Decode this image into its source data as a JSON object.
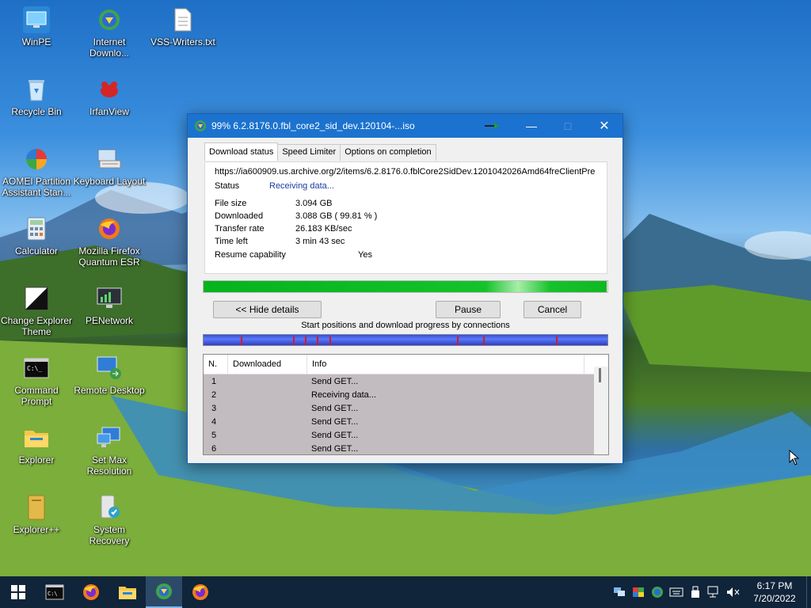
{
  "desktop": {
    "icons": [
      {
        "label": "WinPE"
      },
      {
        "label": "Internet Downlo..."
      },
      {
        "label": "VSS-Writers.txt"
      },
      {
        "label": "Recycle Bin"
      },
      {
        "label": "IrfanView"
      },
      {
        "label": "AOMEI Partition Assistant Stan..."
      },
      {
        "label": "Keyboard Layout"
      },
      {
        "label": "Calculator"
      },
      {
        "label": "Mozilla Firefox Quantum ESR"
      },
      {
        "label": "Change Explorer Theme"
      },
      {
        "label": "PENetwork"
      },
      {
        "label": "Command Prompt"
      },
      {
        "label": "Remote Desktop"
      },
      {
        "label": "Explorer"
      },
      {
        "label": "Set Max Resolution"
      },
      {
        "label": "Explorer++"
      },
      {
        "label": "System Recovery"
      }
    ]
  },
  "window": {
    "title": "99% 6.2.8176.0.fbl_core2_sid_dev.120104-...iso",
    "tabs": [
      "Download status",
      "Speed Limiter",
      "Options on completion"
    ],
    "url": "https://ia600909.us.archive.org/2/items/6.2.8176.0.fblCore2SidDev.1201042026Amd64freClientPre",
    "status_label": "Status",
    "status_value": "Receiving data...",
    "file_size_label": "File size",
    "file_size_value": "3.094  GB",
    "downloaded_label": "Downloaded",
    "downloaded_value": "3.088  GB  ( 99.81 % )",
    "transfer_rate_label": "Transfer rate",
    "transfer_rate_value": "26.183  KB/sec",
    "time_left_label": "Time left",
    "time_left_value": "3 min 43 sec",
    "resume_label": "Resume capability",
    "resume_value": "Yes",
    "progress_fraction": 0.9981,
    "hide_details_label": "<< Hide details",
    "pause_label": "Pause",
    "cancel_label": "Cancel",
    "connections_caption": "Start positions and download progress by connections",
    "list_headers": [
      "N.",
      "Downloaded",
      "Info"
    ],
    "list_rows": [
      {
        "n": "1",
        "downloaded": "",
        "info": "Send GET..."
      },
      {
        "n": "2",
        "downloaded": "",
        "info": "Receiving data..."
      },
      {
        "n": "3",
        "downloaded": "",
        "info": "Send GET..."
      },
      {
        "n": "4",
        "downloaded": "",
        "info": "Send GET..."
      },
      {
        "n": "5",
        "downloaded": "",
        "info": "Send GET..."
      },
      {
        "n": "6",
        "downloaded": "",
        "info": "Send GET..."
      }
    ]
  },
  "taskbar": {
    "clock_time": "6:17 PM",
    "clock_date": "7/20/2022"
  },
  "colors": {
    "titlebar": "#1c73cf",
    "progress": "#15c22a",
    "status_text": "#1a3c9e"
  }
}
